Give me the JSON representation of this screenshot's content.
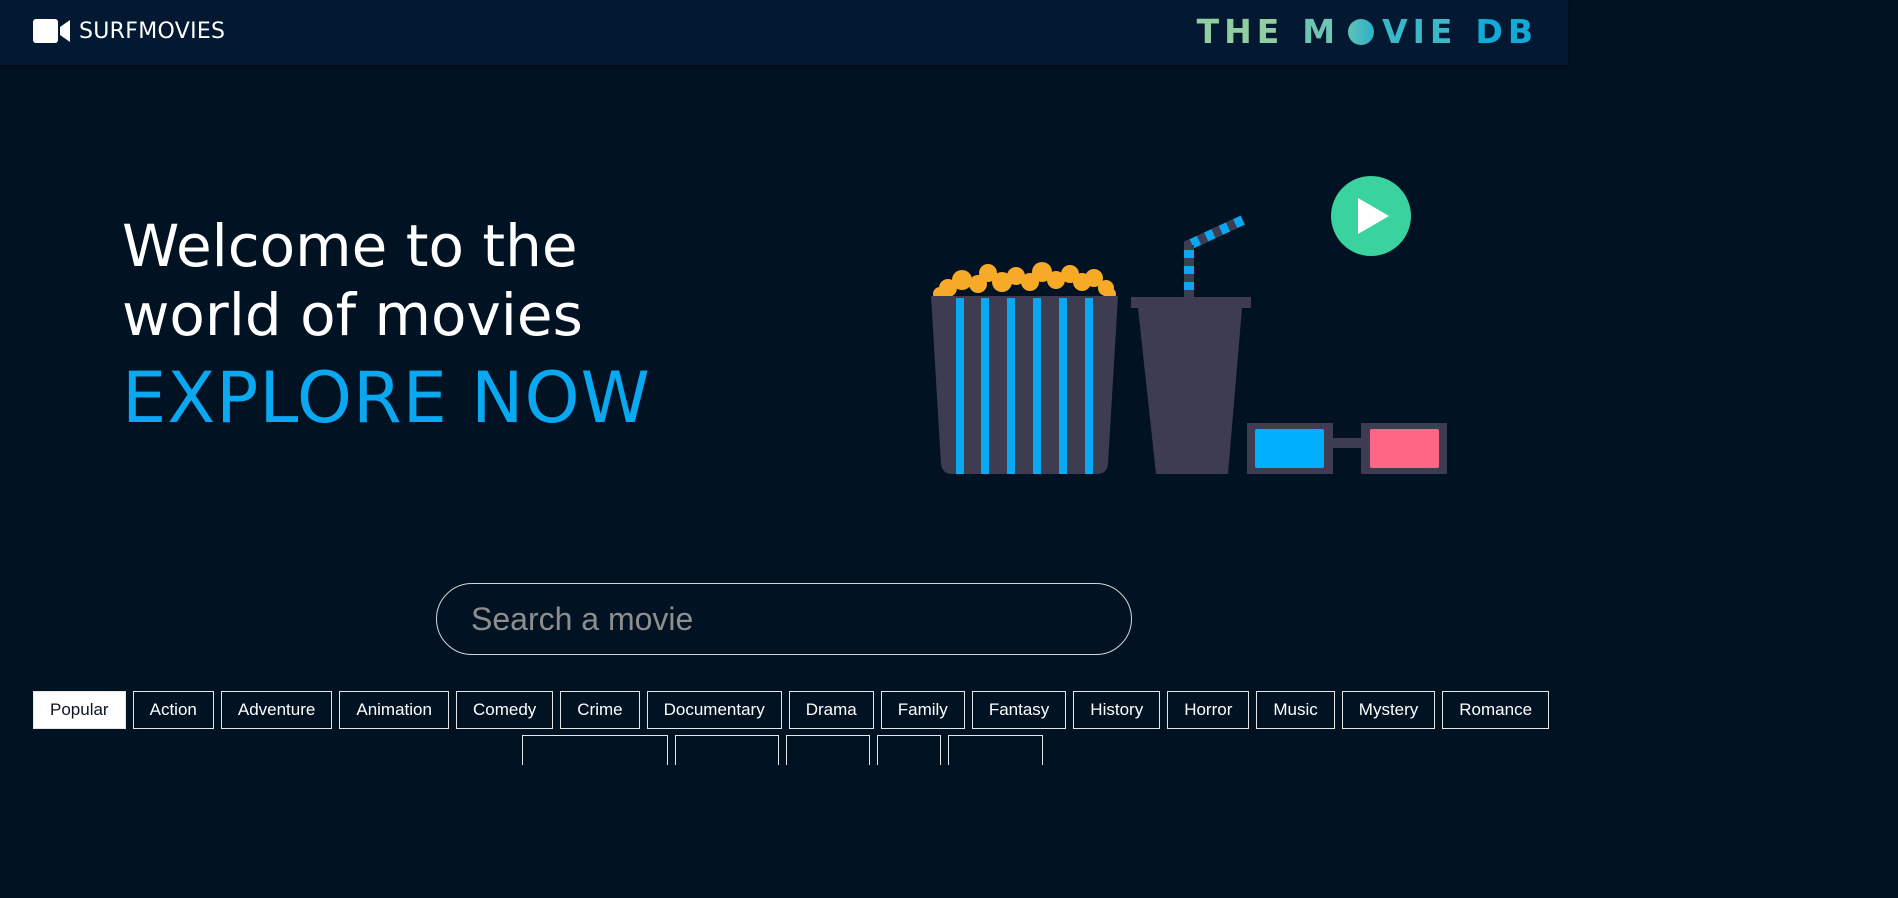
{
  "header": {
    "brand_name": "SURFMOVIES",
    "brand_icon": "video-camera-icon",
    "partner_logo": {
      "the": "THE",
      "m": "M",
      "vie": "VIE",
      "db": "DB"
    }
  },
  "hero": {
    "line1": "Welcome to the",
    "line2": "world of movies",
    "cta": "EXPLORE NOW"
  },
  "search": {
    "placeholder": "Search a movie",
    "value": ""
  },
  "genres": [
    {
      "label": "Popular",
      "active": true
    },
    {
      "label": "Action",
      "active": false
    },
    {
      "label": "Adventure",
      "active": false
    },
    {
      "label": "Animation",
      "active": false
    },
    {
      "label": "Comedy",
      "active": false
    },
    {
      "label": "Crime",
      "active": false
    },
    {
      "label": "Documentary",
      "active": false
    },
    {
      "label": "Drama",
      "active": false
    },
    {
      "label": "Family",
      "active": false
    },
    {
      "label": "Fantasy",
      "active": false
    },
    {
      "label": "History",
      "active": false
    },
    {
      "label": "Horror",
      "active": false
    },
    {
      "label": "Music",
      "active": false
    },
    {
      "label": "Mystery",
      "active": false
    },
    {
      "label": "Romance",
      "active": false
    }
  ],
  "colors": {
    "background": "#011222",
    "header_bg": "#021931",
    "accent": "#0aa8f0",
    "play_button": "#3ad29f",
    "popcorn": "#f7a928",
    "cup": "#3d3c51",
    "lens_left": "#00b0ff",
    "lens_right": "#ff6584"
  }
}
